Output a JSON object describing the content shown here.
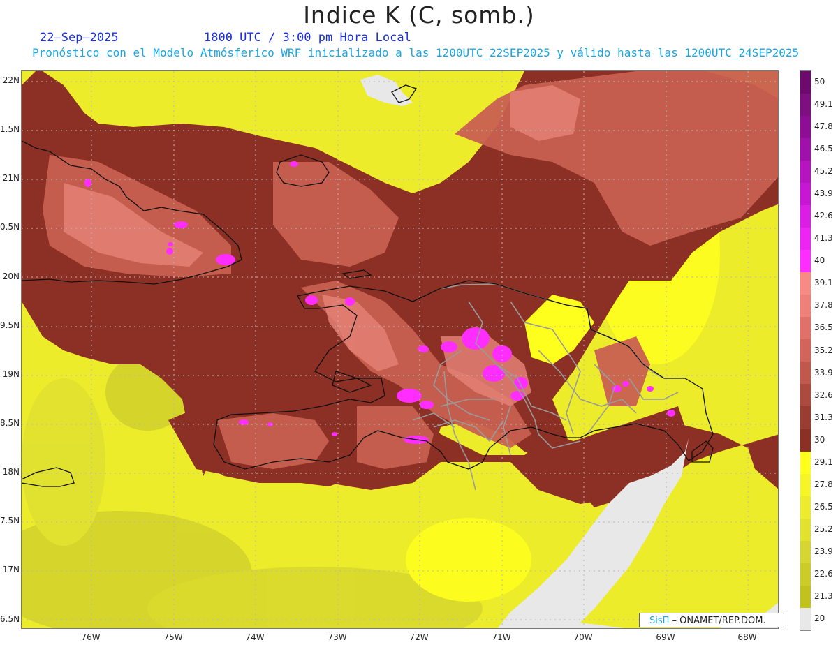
{
  "title": "Indice K (C, somb.)",
  "header": {
    "date": "22–Sep–2025",
    "time": "1800 UTC / 3:00 pm Hora Local",
    "description": "Pronóstico con el Modelo Atmósferico WRF inicializado a las 1200UTC_22SEP2025 y válido hasta las  1200UTC_24SEP2025"
  },
  "credit": {
    "logo": "SisΠ",
    "text": " – ONAMET/REP.DOM."
  },
  "chart_data": {
    "type": "heatmap",
    "title": "Indice K (C, somb.)",
    "xlim": [
      -76.65,
      -67.65
    ],
    "ylim": [
      16.45,
      22.12
    ],
    "x_ticks": [
      {
        "value": -76,
        "label": "76W"
      },
      {
        "value": -75,
        "label": "75W"
      },
      {
        "value": -74,
        "label": "74W"
      },
      {
        "value": -73,
        "label": "73W"
      },
      {
        "value": -72,
        "label": "72W"
      },
      {
        "value": -71,
        "label": "71W"
      },
      {
        "value": -70,
        "label": "70W"
      },
      {
        "value": -69,
        "label": "69W"
      },
      {
        "value": -68,
        "label": "68W"
      }
    ],
    "y_ticks": [
      {
        "value": 22,
        "label": "22N"
      },
      {
        "value": 21.5,
        "label": "1.5N"
      },
      {
        "value": 21,
        "label": "21N"
      },
      {
        "value": 20.5,
        "label": "0.5N"
      },
      {
        "value": 20,
        "label": "20N"
      },
      {
        "value": 19.5,
        "label": "9.5N"
      },
      {
        "value": 19,
        "label": "19N"
      },
      {
        "value": 18.5,
        "label": "8.5N"
      },
      {
        "value": 18,
        "label": "18N"
      },
      {
        "value": 17.5,
        "label": "7.5N"
      },
      {
        "value": 17,
        "label": "17N"
      },
      {
        "value": 16.5,
        "label": "6.5N"
      }
    ],
    "colorbar": {
      "levels": [
        "50",
        "49.1",
        "47.8",
        "46.5",
        "45.2",
        "43.9",
        "42.6",
        "41.3",
        "40",
        "39.1",
        "37.8",
        "36.5",
        "35.2",
        "33.9",
        "32.6",
        "31.3",
        "30",
        "29.1",
        "27.8",
        "26.5",
        "25.2",
        "23.9",
        "22.6",
        "21.3",
        "20"
      ],
      "colors": [
        "#6e0a6e",
        "#7d0f80",
        "#8e0d95",
        "#a010aa",
        "#b514bf",
        "#c817d4",
        "#db1de6",
        "#ed24f4",
        "#ff2dff",
        "#f88a86",
        "#ee8078",
        "#e07068",
        "#d2645a",
        "#c0584c",
        "#ac4a3e",
        "#9a3c32",
        "#8c3026",
        "#ffff1e",
        "#f6f626",
        "#ecec2c",
        "#e2e22e",
        "#d6d630",
        "#cccc26",
        "#c2c21c",
        "#e8e8e8"
      ]
    },
    "grid": true
  }
}
